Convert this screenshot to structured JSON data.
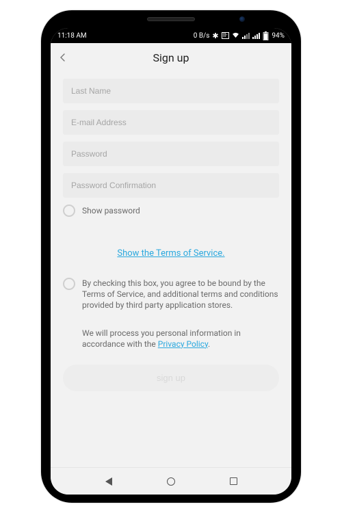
{
  "status": {
    "time": "11:18 AM",
    "net_speed": "0 B/s",
    "battery_pct": "94%"
  },
  "header": {
    "title": "Sign up"
  },
  "fields": {
    "last_name_ph": "Last Name",
    "email_ph": "E-mail Address",
    "password_ph": "Password",
    "password_confirm_ph": "Password Confirmation"
  },
  "show_password_label": "Show password",
  "tos_link_label": "Show the Terms of Service.",
  "agree_text": "By checking this box, you agree to be bound by the Terms of Service, and additional terms and conditions provided by third party application stores.",
  "privacy_prefix": "We will process you personal information in accordance with the ",
  "privacy_link_label": "Privacy Policy",
  "privacy_suffix": ".",
  "signup_button_label": "sign up"
}
